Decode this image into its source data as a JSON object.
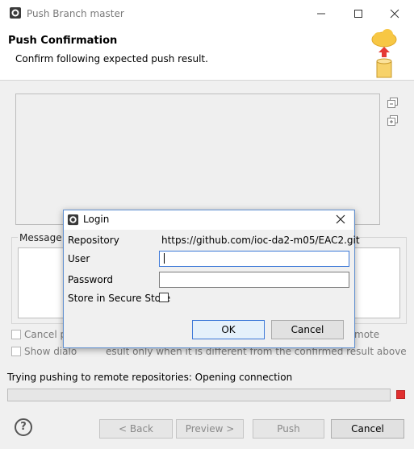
{
  "window": {
    "title": "Push Branch master",
    "minimize_icon": "minimize-icon",
    "maximize_icon": "maximize-icon",
    "close_icon": "close-icon"
  },
  "header": {
    "title": "Push Confirmation",
    "subtitle": "Confirm following expected push result.",
    "banner_icon": "cloud-push-database-icon"
  },
  "side_icons": [
    "collapse-all-icon",
    "expand-all-icon"
  ],
  "message": {
    "label": "Message D"
  },
  "options": {
    "cancel_label_left": "Cancel pu",
    "cancel_label_right": "mote",
    "show_label_left": "Show dialo",
    "show_label_right": "esult only when it is different from the confirmed result above"
  },
  "status": {
    "text": "Trying pushing to remote repositories: Opening connection",
    "progress": 0
  },
  "buttons": {
    "back": "< Back",
    "preview": "Preview >",
    "push": "Push",
    "cancel": "Cancel"
  },
  "login": {
    "title": "Login",
    "repository_label": "Repository",
    "repository_value": "https://github.com/ioc-da2-m05/EAC2.git",
    "user_label": "User",
    "user_value": "",
    "password_label": "Password",
    "password_value": "",
    "store_label": "Store in Secure Store",
    "store_checked": false,
    "ok": "OK",
    "cancel": "Cancel"
  }
}
